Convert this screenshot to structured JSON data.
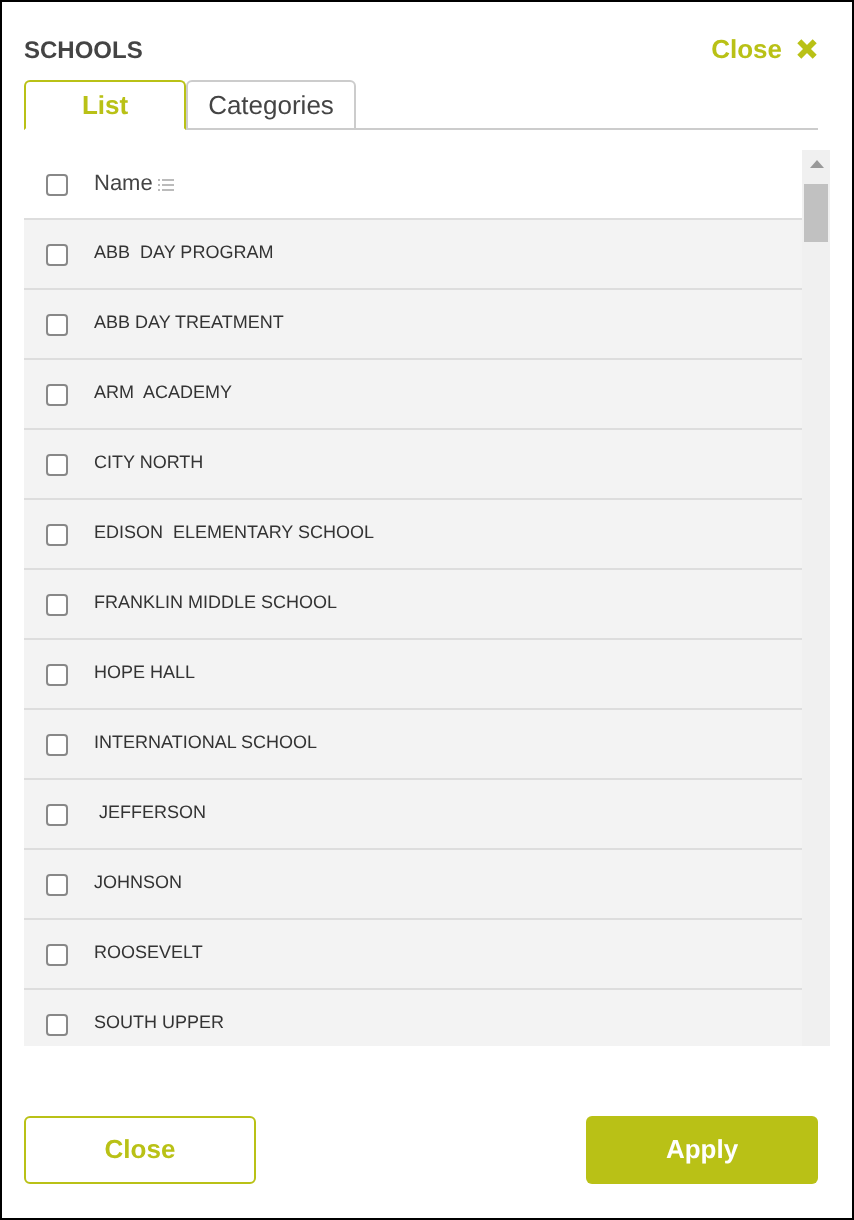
{
  "dialog": {
    "title": "SCHOOLS",
    "close_label": "Close"
  },
  "tabs": [
    {
      "label": "List",
      "selected": true
    },
    {
      "label": "Categories",
      "selected": false
    }
  ],
  "table": {
    "select_all": {
      "checked": false
    },
    "column": "Name",
    "rows": [
      {
        "name": "ABB  DAY PROGRAM",
        "checked": false
      },
      {
        "name": "ABB DAY TREATMENT",
        "checked": false
      },
      {
        "name": "ARM  ACADEMY",
        "checked": false
      },
      {
        "name": "CITY NORTH",
        "checked": false
      },
      {
        "name": "EDISON  ELEMENTARY SCHOOL",
        "checked": false
      },
      {
        "name": "FRANKLIN MIDDLE SCHOOL",
        "checked": false
      },
      {
        "name": "HOPE HALL",
        "checked": false
      },
      {
        "name": "INTERNATIONAL SCHOOL",
        "checked": false
      },
      {
        "name": " JEFFERSON",
        "checked": false
      },
      {
        "name": "JOHNSON",
        "checked": false
      },
      {
        "name": "ROOSEVELT",
        "checked": false
      },
      {
        "name": "SOUTH UPPER",
        "checked": false
      }
    ]
  },
  "buttons": [
    {
      "label": "Close",
      "kind": "secondary"
    },
    {
      "label": "Apply",
      "kind": "primary"
    }
  ]
}
